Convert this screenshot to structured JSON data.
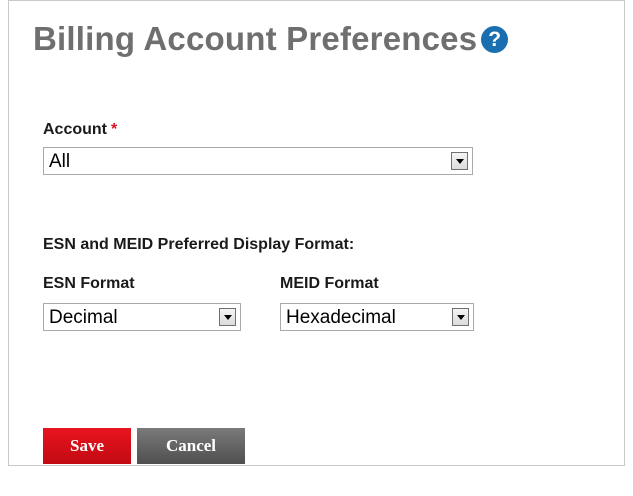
{
  "header": {
    "title": "Billing Account Preferences",
    "help_icon": "?"
  },
  "account": {
    "label": "Account",
    "required_marker": "*",
    "selected": "All"
  },
  "display_format": {
    "heading": "ESN and MEID Preferred Display Format:",
    "esn": {
      "label": "ESN Format",
      "selected": "Decimal"
    },
    "meid": {
      "label": "MEID Format",
      "selected": "Hexadecimal"
    }
  },
  "buttons": {
    "save": "Save",
    "cancel": "Cancel"
  },
  "colors": {
    "save": "#d8121f",
    "cancel": "#5f5f5f",
    "help": "#1a6fb0",
    "required": "#d8121f"
  }
}
